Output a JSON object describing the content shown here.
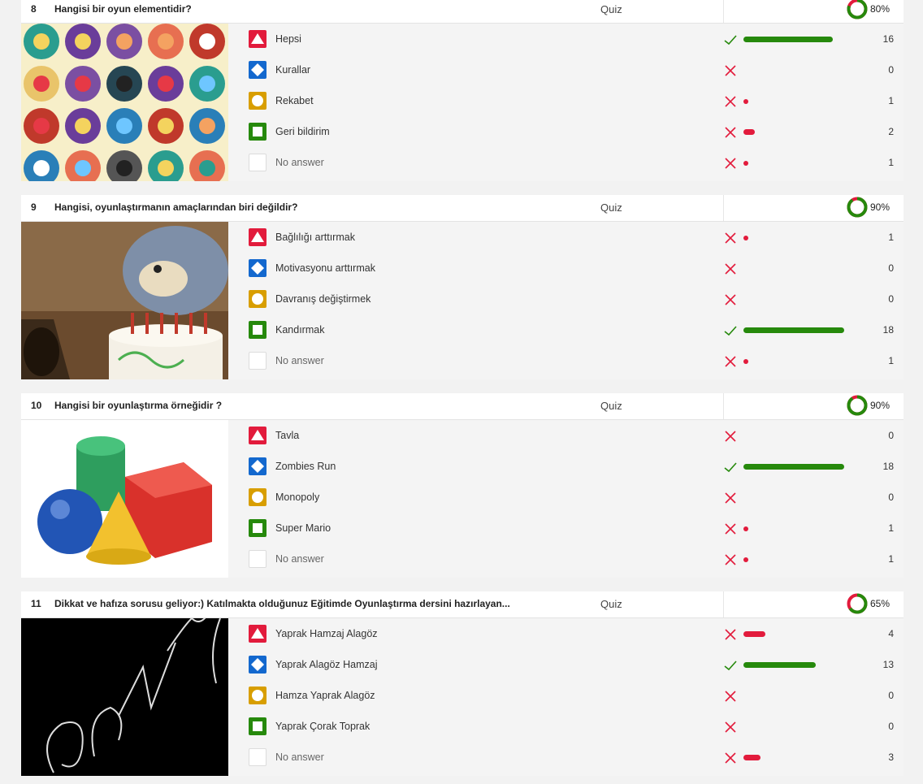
{
  "questions": [
    {
      "number": "8",
      "title": "Hangisi bir oyun elementidir?",
      "type": "Quiz",
      "percent_label": "80%",
      "percent": 0.8,
      "image": "game-icons-grid",
      "answers": [
        {
          "shape": "triangle",
          "color": "red",
          "label": "Hepsi",
          "correct": true,
          "count": "16",
          "fraction": 0.89
        },
        {
          "shape": "diamond",
          "color": "blue",
          "label": "Kurallar",
          "correct": false,
          "count": "0",
          "fraction": 0
        },
        {
          "shape": "circle",
          "color": "yellow",
          "label": "Rekabet",
          "correct": false,
          "count": "1",
          "fraction": 0.05
        },
        {
          "shape": "square",
          "color": "green",
          "label": "Geri bildirim",
          "correct": false,
          "count": "2",
          "fraction": 0.11
        },
        {
          "shape": "none",
          "color": "none",
          "label": "No answer",
          "correct": false,
          "count": "1",
          "fraction": 0.05
        }
      ]
    },
    {
      "number": "9",
      "title": "Hangisi, oyunlaştırmanın amaçlarından biri değildir?",
      "type": "Quiz",
      "percent_label": "90%",
      "percent": 0.9,
      "image": "cartoon-cat-cake",
      "answers": [
        {
          "shape": "triangle",
          "color": "red",
          "label": "Bağlılığı arttırmak",
          "correct": false,
          "count": "1",
          "fraction": 0.05
        },
        {
          "shape": "diamond",
          "color": "blue",
          "label": "Motivasyonu arttırmak",
          "correct": false,
          "count": "0",
          "fraction": 0
        },
        {
          "shape": "circle",
          "color": "yellow",
          "label": "Davranış değiştirmek",
          "correct": false,
          "count": "0",
          "fraction": 0
        },
        {
          "shape": "square",
          "color": "green",
          "label": "Kandırmak",
          "correct": true,
          "count": "18",
          "fraction": 1.0
        },
        {
          "shape": "none",
          "color": "none",
          "label": "No answer",
          "correct": false,
          "count": "1",
          "fraction": 0.05
        }
      ]
    },
    {
      "number": "10",
      "title": "Hangisi bir oyunlaştırma örneğidir ?",
      "type": "Quiz",
      "percent_label": "90%",
      "percent": 0.9,
      "image": "3d-shapes",
      "answers": [
        {
          "shape": "triangle",
          "color": "red",
          "label": "Tavla",
          "correct": false,
          "count": "0",
          "fraction": 0
        },
        {
          "shape": "diamond",
          "color": "blue",
          "label": "Zombies Run",
          "correct": true,
          "count": "18",
          "fraction": 1.0
        },
        {
          "shape": "circle",
          "color": "yellow",
          "label": "Monopoly",
          "correct": false,
          "count": "0",
          "fraction": 0
        },
        {
          "shape": "square",
          "color": "green",
          "label": "Super Mario",
          "correct": false,
          "count": "1",
          "fraction": 0.05
        },
        {
          "shape": "none",
          "color": "none",
          "label": "No answer",
          "correct": false,
          "count": "1",
          "fraction": 0.05
        }
      ]
    },
    {
      "number": "11",
      "title": "Dikkat ve hafıza sorusu geliyor:) Katılmakta olduğunuz Eğitimde Oyunlaştırma dersini hazırlayan...",
      "type": "Quiz",
      "percent_label": "65%",
      "percent": 0.65,
      "image": "chalk-scribble",
      "answers": [
        {
          "shape": "triangle",
          "color": "red",
          "label": "Yaprak Hamzaj Alagöz",
          "correct": false,
          "count": "4",
          "fraction": 0.22
        },
        {
          "shape": "diamond",
          "color": "blue",
          "label": "Yaprak Alagöz Hamzaj",
          "correct": true,
          "count": "13",
          "fraction": 0.72
        },
        {
          "shape": "circle",
          "color": "yellow",
          "label": "Hamza Yaprak Alagöz",
          "correct": false,
          "count": "0",
          "fraction": 0
        },
        {
          "shape": "square",
          "color": "green",
          "label": "Yaprak Çorak Toprak",
          "correct": false,
          "count": "0",
          "fraction": 0
        },
        {
          "shape": "none",
          "color": "none",
          "label": "No answer",
          "correct": false,
          "count": "3",
          "fraction": 0.17
        }
      ]
    }
  ],
  "colors": {
    "correct": "#26890c",
    "wrong": "#e21b3c",
    "red": "#e21b3c",
    "blue": "#1368ce",
    "yellow": "#d89e00",
    "green": "#26890c"
  }
}
